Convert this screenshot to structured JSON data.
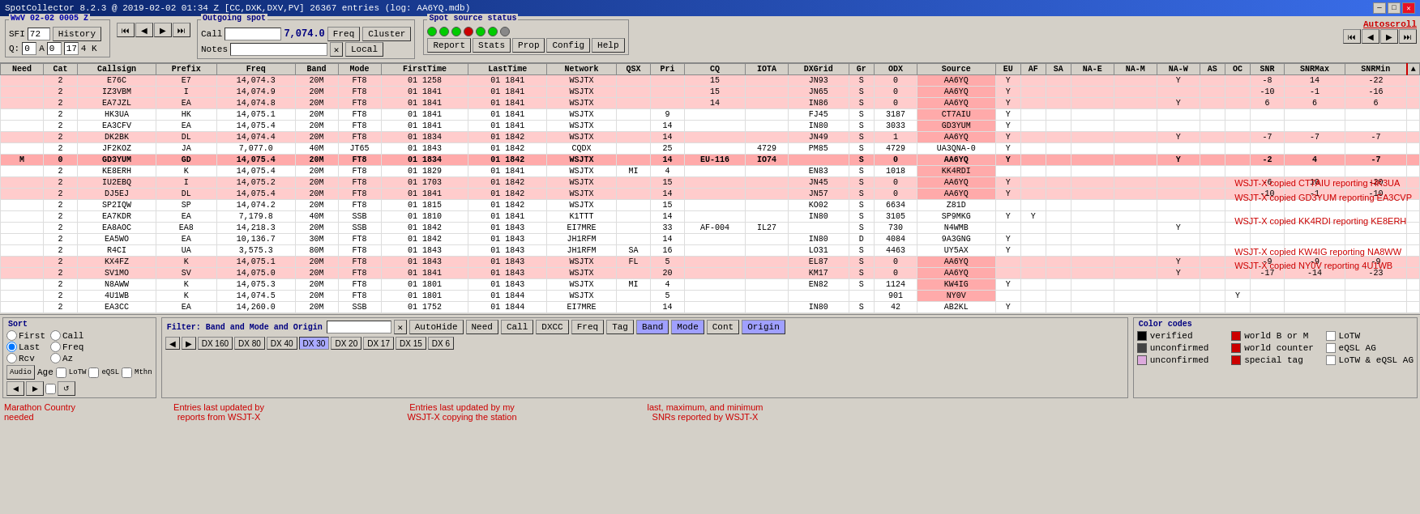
{
  "title_bar": {
    "title": "SpotCollector 8.2.3 @ 2019-02-02  01:34 Z [CC,DXK,DXV,PV] 26367 entries (log: AA6YQ.mdb)",
    "min_btn": "─",
    "max_btn": "□",
    "close_btn": "✕"
  },
  "wwv": {
    "label": "WwV 02-02 0005 Z",
    "sfi_label": "SFI",
    "sfi_value": "72",
    "history_btn": "History",
    "a_label": "A",
    "a_value": "0",
    "k_label": "K",
    "k_value": "17",
    "four_k": "4 K"
  },
  "outgoing_spot": {
    "label": "Outgoing spot",
    "call_label": "Call",
    "call_value": "",
    "freq_value": "7,074.0",
    "freq_btn": "Freq",
    "cluster_btn": "Cluster",
    "notes_label": "Notes",
    "notes_value": "",
    "clear_btn": "✕",
    "local_btn": "Local"
  },
  "spot_source": {
    "label": "Spot source status",
    "report_btn": "Report",
    "stats_btn": "Stats",
    "prop_btn": "Prop",
    "config_btn": "Config",
    "help_btn": "Help"
  },
  "autoscroll": {
    "label": "Autoscroll"
  },
  "nav": {
    "prev_prev": "⏮",
    "prev": "◀",
    "next": "▶",
    "next_next": "⏭"
  },
  "q_label": "Q:",
  "q_value": "0",
  "table": {
    "headers": [
      "Need",
      "Cat",
      "Callsign",
      "Prefix",
      "Freq",
      "Band",
      "Mode",
      "FirstTime",
      "LastTime",
      "Network",
      "QSX",
      "Pri",
      "CQ",
      "IOTA",
      "DXGrid",
      "Gr",
      "ODX",
      "Source",
      "EU",
      "AF",
      "SA",
      "NA-E",
      "NA-M",
      "NA-W",
      "AS",
      "OC",
      "SNR",
      "SNRMax",
      "SNRMin"
    ],
    "rows": [
      {
        "need": "",
        "cat": "2",
        "callsign": "E76C",
        "prefix": "E7",
        "freq": "14,074.3",
        "band": "20M",
        "mode": "FT8",
        "firsttime": "01 1258",
        "lasttime": "01 1841",
        "network": "WSJTX",
        "qsx": "",
        "pri": "",
        "cq": "15",
        "iota": "",
        "dxgrid": "JN93",
        "gr": "S",
        "odx": "0",
        "source": "AA6YQ",
        "eu": "Y",
        "af": "",
        "sa": "",
        "nae": "",
        "nam": "",
        "naw": "Y",
        "as": "",
        "oc": "",
        "snr": "-8",
        "snrmax": "14",
        "snrmin": "-22",
        "rowclass": "row-pink"
      },
      {
        "need": "",
        "cat": "2",
        "callsign": "IZ3VBM",
        "prefix": "I",
        "freq": "14,074.9",
        "band": "20M",
        "mode": "FT8",
        "firsttime": "01 1841",
        "lasttime": "01 1841",
        "network": "WSJTX",
        "qsx": "",
        "pri": "",
        "cq": "15",
        "iota": "",
        "dxgrid": "JN65",
        "gr": "S",
        "odx": "0",
        "source": "AA6YQ",
        "eu": "Y",
        "af": "",
        "sa": "",
        "nae": "",
        "nam": "",
        "naw": "",
        "as": "",
        "oc": "",
        "snr": "-10",
        "snrmax": "-1",
        "snrmin": "-16",
        "rowclass": "row-pink"
      },
      {
        "need": "",
        "cat": "2",
        "callsign": "EA7JZL",
        "prefix": "EA",
        "freq": "14,074.8",
        "band": "20M",
        "mode": "FT8",
        "firsttime": "01 1841",
        "lasttime": "01 1841",
        "network": "WSJTX",
        "qsx": "",
        "pri": "",
        "cq": "14",
        "iota": "",
        "dxgrid": "IN86",
        "gr": "S",
        "odx": "0",
        "source": "AA6YQ",
        "eu": "Y",
        "af": "",
        "sa": "",
        "nae": "",
        "nam": "",
        "naw": "Y",
        "as": "",
        "oc": "",
        "snr": "6",
        "snrmax": "6",
        "snrmin": "6",
        "rowclass": "row-pink"
      },
      {
        "need": "",
        "cat": "2",
        "callsign": "HK3UA",
        "prefix": "HK",
        "freq": "14,075.1",
        "band": "20M",
        "mode": "FT8",
        "firsttime": "01 1841",
        "lasttime": "01 1841",
        "network": "WSJTX",
        "qsx": "",
        "pri": "9",
        "cq": "",
        "iota": "",
        "dxgrid": "FJ45",
        "gr": "S",
        "odx": "3187",
        "source": "CT7AIU",
        "eu": "Y",
        "af": "",
        "sa": "",
        "nae": "",
        "nam": "",
        "naw": "",
        "as": "",
        "oc": "",
        "snr": "",
        "snrmax": "",
        "snrmin": "",
        "rowclass": "row-white"
      },
      {
        "need": "",
        "cat": "2",
        "callsign": "EA3CFV",
        "prefix": "EA",
        "freq": "14,075.4",
        "band": "20M",
        "mode": "FT8",
        "firsttime": "01 1841",
        "lasttime": "01 1841",
        "network": "WSJTX",
        "qsx": "",
        "pri": "14",
        "cq": "",
        "iota": "",
        "dxgrid": "IN80",
        "gr": "S",
        "odx": "3033",
        "source": "GD3YUM",
        "eu": "Y",
        "af": "",
        "sa": "",
        "nae": "",
        "nam": "",
        "naw": "",
        "as": "",
        "oc": "",
        "snr": "",
        "snrmax": "",
        "snrmin": "",
        "rowclass": "row-white"
      },
      {
        "need": "",
        "cat": "2",
        "callsign": "DK2BK",
        "prefix": "DL",
        "freq": "14,074.4",
        "band": "20M",
        "mode": "FT8",
        "firsttime": "01 1834",
        "lasttime": "01 1842",
        "network": "WSJTX",
        "qsx": "",
        "pri": "14",
        "cq": "",
        "iota": "",
        "dxgrid": "JN49",
        "gr": "S",
        "odx": "1",
        "source": "AA6YQ",
        "eu": "Y",
        "af": "",
        "sa": "",
        "nae": "",
        "nam": "",
        "naw": "Y",
        "as": "",
        "oc": "",
        "snr": "-7",
        "snrmax": "-7",
        "snrmin": "-7",
        "rowclass": "row-pink"
      },
      {
        "need": "",
        "cat": "2",
        "callsign": "JF2KOZ",
        "prefix": "JA",
        "freq": "7,077.0",
        "band": "40M",
        "mode": "JT65",
        "firsttime": "01 1843",
        "lasttime": "01 1842",
        "network": "CQDX",
        "qsx": "",
        "pri": "25",
        "cq": "",
        "iota": "4729",
        "dxgrid": "PM85",
        "gr": "S",
        "odx": "4729",
        "source": "UA3QNA-0",
        "eu": "Y",
        "af": "",
        "sa": "",
        "nae": "",
        "nam": "",
        "naw": "",
        "as": "",
        "oc": "",
        "snr": "",
        "snrmax": "",
        "snrmin": "",
        "rowclass": "row-white"
      },
      {
        "need": "M",
        "cat": "0",
        "callsign": "GD3YUM",
        "prefix": "GD",
        "freq": "14,075.4",
        "band": "20M",
        "mode": "FT8",
        "firsttime": "01 1834",
        "lasttime": "01 1842",
        "network": "WSJTX",
        "qsx": "",
        "pri": "14",
        "cq": "EU-116",
        "iota": "IO74",
        "gr": "S",
        "odx": "0",
        "source": "AA6YQ",
        "eu": "Y",
        "af": "",
        "sa": "",
        "nae": "",
        "nam": "",
        "naw": "Y",
        "as": "",
        "oc": "",
        "snr": "-2",
        "snrmax": "4",
        "snrmin": "-7",
        "rowclass": "highlight-row"
      },
      {
        "need": "",
        "cat": "2",
        "callsign": "KE8ERH",
        "prefix": "K",
        "freq": "14,075.4",
        "band": "20M",
        "mode": "FT8",
        "firsttime": "01 1829",
        "lasttime": "01 1841",
        "network": "WSJTX",
        "qsx": "MI",
        "pri": "4",
        "cq": "",
        "iota": "",
        "dxgrid": "EN83",
        "gr": "S",
        "odx": "1018",
        "source": "KK4RDI",
        "eu": "",
        "af": "",
        "sa": "",
        "nae": "",
        "nam": "",
        "naw": "",
        "as": "",
        "oc": "",
        "snr": "",
        "snrmax": "",
        "snrmin": "",
        "rowclass": "row-white"
      },
      {
        "need": "",
        "cat": "2",
        "callsign": "IU2EBQ",
        "prefix": "I",
        "freq": "14,075.2",
        "band": "20M",
        "mode": "FT8",
        "firsttime": "01 1703",
        "lasttime": "01 1842",
        "network": "WSJTX",
        "qsx": "",
        "pri": "15",
        "cq": "",
        "iota": "",
        "dxgrid": "JN45",
        "gr": "S",
        "odx": "0",
        "source": "AA6YQ",
        "eu": "Y",
        "af": "",
        "sa": "",
        "nae": "",
        "nam": "",
        "naw": "",
        "as": "",
        "oc": "",
        "snr": "-6",
        "snrmax": "10",
        "snrmin": "-20",
        "rowclass": "row-pink"
      },
      {
        "need": "",
        "cat": "2",
        "callsign": "DJ5EJ",
        "prefix": "DL",
        "freq": "14,075.4",
        "band": "20M",
        "mode": "FT8",
        "firsttime": "01 1841",
        "lasttime": "01 1842",
        "network": "WSJTX",
        "qsx": "",
        "pri": "14",
        "cq": "",
        "iota": "",
        "dxgrid": "JN57",
        "gr": "S",
        "odx": "0",
        "source": "AA6YQ",
        "eu": "Y",
        "af": "",
        "sa": "",
        "nae": "",
        "nam": "",
        "naw": "",
        "as": "",
        "oc": "",
        "snr": "-10",
        "snrmax": "-1",
        "snrmin": "-10",
        "rowclass": "row-pink"
      },
      {
        "need": "",
        "cat": "2",
        "callsign": "SP2IQW",
        "prefix": "SP",
        "freq": "14,074.2",
        "band": "20M",
        "mode": "FT8",
        "firsttime": "01 1815",
        "lasttime": "01 1842",
        "network": "WSJTX",
        "qsx": "",
        "pri": "15",
        "cq": "",
        "iota": "",
        "dxgrid": "KO02",
        "gr": "S",
        "odx": "6634",
        "source": "Z81D",
        "eu": "",
        "af": "",
        "sa": "",
        "nae": "",
        "nam": "",
        "naw": "",
        "as": "",
        "oc": "",
        "snr": "",
        "snrmax": "",
        "snrmin": "",
        "rowclass": "row-white"
      },
      {
        "need": "",
        "cat": "2",
        "callsign": "EA7KDR",
        "prefix": "EA",
        "freq": "7,179.8",
        "band": "40M",
        "mode": "SSB",
        "firsttime": "01 1810",
        "lasttime": "01 1841",
        "network": "K1TTT",
        "qsx": "",
        "pri": "14",
        "cq": "",
        "iota": "",
        "dxgrid": "IN80",
        "gr": "S",
        "odx": "3105",
        "source": "SP9MKG",
        "eu": "Y",
        "af": "Y",
        "sa": "",
        "nae": "",
        "nam": "",
        "naw": "",
        "as": "",
        "oc": "",
        "snr": "",
        "snrmax": "",
        "snrmin": "",
        "rowclass": "row-white"
      },
      {
        "need": "",
        "cat": "2",
        "callsign": "EA8AOC",
        "prefix": "EA8",
        "freq": "14,218.3",
        "band": "20M",
        "mode": "SSB",
        "firsttime": "01 1842",
        "lasttime": "01 1843",
        "network": "EI7MRE",
        "qsx": "",
        "pri": "33",
        "cq": "AF-004",
        "iota": "IL27",
        "gr": "S",
        "odx": "730",
        "source": "N4WMB",
        "eu": "",
        "af": "",
        "sa": "",
        "nae": "",
        "nam": "",
        "naw": "Y",
        "as": "",
        "oc": "",
        "snr": "",
        "snrmax": "",
        "snrmin": "",
        "rowclass": "row-white"
      },
      {
        "need": "",
        "cat": "2",
        "callsign": "EA5WO",
        "prefix": "EA",
        "freq": "10,136.7",
        "band": "30M",
        "mode": "FT8",
        "firsttime": "01 1842",
        "lasttime": "01 1843",
        "network": "JH1RFM",
        "qsx": "",
        "pri": "14",
        "cq": "",
        "iota": "",
        "dxgrid": "IN80",
        "gr": "D",
        "odx": "4084",
        "source": "9A3GNG",
        "eu": "Y",
        "af": "",
        "sa": "",
        "nae": "",
        "nam": "",
        "naw": "",
        "as": "",
        "oc": "",
        "snr": "",
        "snrmax": "",
        "snrmin": "",
        "rowclass": "row-white"
      },
      {
        "need": "",
        "cat": "2",
        "callsign": "R4CI",
        "prefix": "UA",
        "freq": "3,575.3",
        "band": "80M",
        "mode": "FT8",
        "firsttime": "01 1843",
        "lasttime": "01 1843",
        "network": "JH1RFM",
        "qsx": "SA",
        "pri": "16",
        "cq": "",
        "iota": "",
        "dxgrid": "LO31",
        "gr": "S",
        "odx": "4463",
        "source": "UY5AX",
        "eu": "Y",
        "af": "",
        "sa": "",
        "nae": "",
        "nam": "",
        "naw": "",
        "as": "",
        "oc": "",
        "snr": "",
        "snrmax": "",
        "snrmin": "",
        "rowclass": "row-white"
      },
      {
        "need": "",
        "cat": "2",
        "callsign": "KX4FZ",
        "prefix": "K",
        "freq": "14,075.1",
        "band": "20M",
        "mode": "FT8",
        "firsttime": "01 1843",
        "lasttime": "01 1843",
        "network": "WSJTX",
        "qsx": "FL",
        "pri": "5",
        "cq": "",
        "iota": "",
        "dxgrid": "EL87",
        "gr": "S",
        "odx": "0",
        "source": "AA6YQ",
        "eu": "",
        "af": "",
        "sa": "",
        "nae": "",
        "nam": "",
        "naw": "Y",
        "as": "",
        "oc": "",
        "snr": "-9",
        "snrmax": "-9",
        "snrmin": "-9",
        "rowclass": "row-pink"
      },
      {
        "need": "",
        "cat": "2",
        "callsign": "SV1MO",
        "prefix": "SV",
        "freq": "14,075.0",
        "band": "20M",
        "mode": "FT8",
        "firsttime": "01 1841",
        "lasttime": "01 1843",
        "network": "WSJTX",
        "qsx": "",
        "pri": "20",
        "cq": "",
        "iota": "",
        "dxgrid": "KM17",
        "gr": "S",
        "odx": "0",
        "source": "AA6YQ",
        "eu": "",
        "af": "",
        "sa": "",
        "nae": "",
        "nam": "",
        "naw": "Y",
        "as": "",
        "oc": "",
        "snr": "-17",
        "snrmax": "-14",
        "snrmin": "-23",
        "rowclass": "row-pink"
      },
      {
        "need": "",
        "cat": "2",
        "callsign": "N8AWW",
        "prefix": "K",
        "freq": "14,075.3",
        "band": "20M",
        "mode": "FT8",
        "firsttime": "01 1801",
        "lasttime": "01 1843",
        "network": "WSJTX",
        "qsx": "MI",
        "pri": "4",
        "cq": "",
        "iota": "",
        "dxgrid": "EN82",
        "gr": "S",
        "odx": "1124",
        "source": "KW4IG",
        "eu": "Y",
        "af": "",
        "sa": "",
        "nae": "",
        "nam": "",
        "naw": "",
        "as": "",
        "oc": "",
        "snr": "",
        "snrmax": "",
        "snrmin": "",
        "rowclass": "row-white"
      },
      {
        "need": "",
        "cat": "2",
        "callsign": "4U1WB",
        "prefix": "K",
        "freq": "14,074.5",
        "band": "20M",
        "mode": "FT8",
        "firsttime": "01 1801",
        "lasttime": "01 1844",
        "network": "WSJTX",
        "qsx": "",
        "pri": "5",
        "cq": "",
        "iota": "",
        "dxgrid": "",
        "gr": "",
        "odx": "901",
        "source": "NY0V",
        "eu": "",
        "af": "",
        "sa": "",
        "nae": "",
        "nam": "",
        "naw": "",
        "as": "",
        "oc": "Y",
        "snr": "",
        "snrmax": "",
        "snrmin": "",
        "rowclass": "row-white"
      },
      {
        "need": "",
        "cat": "2",
        "callsign": "EA3CC",
        "prefix": "EA",
        "freq": "14,260.0",
        "band": "20M",
        "mode": "SSB",
        "firsttime": "01 1752",
        "lasttime": "01 1844",
        "network": "EI7MRE",
        "qsx": "",
        "pri": "14",
        "cq": "",
        "iota": "",
        "dxgrid": "IN80",
        "gr": "S",
        "odx": "42",
        "source": "AB2KL",
        "eu": "Y",
        "af": "",
        "sa": "",
        "nae": "",
        "nam": "",
        "naw": "",
        "as": "",
        "oc": "",
        "snr": "",
        "snrmax": "",
        "snrmin": "",
        "rowclass": "row-white"
      }
    ]
  },
  "sort": {
    "label": "Sort",
    "first_label": "First",
    "last_label": "Last",
    "rcv_label": "Rcv",
    "call_label": "Call",
    "freq_label": "Freq",
    "az_label": "Az"
  },
  "filter": {
    "label": "Filter: Band and Mode and Origin",
    "autohide_btn": "AutoHide",
    "need_btn": "Need",
    "call_btn": "Call",
    "dxcc_btn": "DXCC",
    "freq_btn": "Freq",
    "tag_btn": "Tag",
    "band_btn": "Band",
    "mode_btn": "Mode",
    "cont_btn": "Cont",
    "origin_btn": "Origin",
    "dx160_btn": "DX 160",
    "dx80_btn": "DX 80",
    "dx40_btn": "DX 40",
    "dx30_btn": "DX 30",
    "dx20_btn": "DX 20",
    "dx17_btn": "DX 17",
    "dx15_btn": "DX 15",
    "dx6_btn": "DX 6"
  },
  "color_codes": {
    "label": "Color codes",
    "items": [
      {
        "color": "#000000",
        "label": "verified"
      },
      {
        "color": "#cc0000",
        "label": "world B or M"
      },
      {
        "color": "#888888",
        "label": "LoTW"
      },
      {
        "color": "#000000",
        "label": "unconfirmed"
      },
      {
        "color": "#cc0000",
        "label": "world counter"
      },
      {
        "color": "#cccccc",
        "label": "eQSL AG"
      },
      {
        "color": "#ccaacc",
        "label": "unconfirmed"
      },
      {
        "color": "#cc0000",
        "label": "special tag"
      },
      {
        "color": "#cccccc",
        "label": "LoTW & eQSL AG"
      }
    ]
  },
  "annotations": {
    "marathon": "Marathon Country needed",
    "entries_wsjt": "Entries last updated by\nreports from WSJT-X",
    "entries_copying": "Entries last updated by my\nWSJT-X copying the station",
    "snr_info": "last, maximum, and minimum\nSNRs reported by WSJT-X"
  },
  "right_messages": {
    "m1": "WSJT-X copied CT7AIU reporting HK3UA",
    "m2": "WSJT-X copied GD3YUM reporting EA3CVP",
    "m3": "WSJT-X copied KK4RDI reporting KE8ERH",
    "m4": "WSJT-X copied KW4IG reporting NA8WW",
    "m5": "WSJT-X copied NY0V reporting 4U1WB"
  }
}
